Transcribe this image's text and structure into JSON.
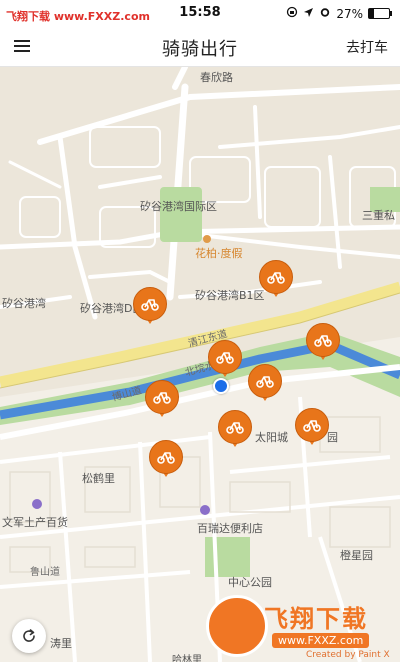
{
  "status_bar": {
    "watermark": "飞翔下载 www.FXXZ.com",
    "time": "15:58",
    "icons": [
      "lock-rotation-icon",
      "location-arrow-icon",
      "alarm-icon"
    ],
    "battery_percent_text": "27%",
    "battery_level": 0.27
  },
  "nav": {
    "menu_icon": "hamburger-menu-icon",
    "title": "骑骑出行",
    "right_action": "去打车"
  },
  "map": {
    "labels": {
      "top_road": "春欣路",
      "district": "矽谷港湾国际区",
      "sanzhong": "三重私",
      "huabo": "花柏·度假",
      "gangwan_left": "矽谷港湾",
      "gangwan_d": "矽谷港湾D区",
      "gangwan_b1": "矽谷港湾B1区",
      "qingjiang_east": "清江东道",
      "north_canal": "北垸水通",
      "boshan": "博山道",
      "taiyang": "太阳城",
      "taiyang_suffix": "园",
      "songhe": "松鹤里",
      "wenjun": "文军土产百货",
      "bairuida": "百瑞达便利店",
      "lushan": "鲁山道",
      "chenghuang": "橙星园",
      "central_park": "中心公园",
      "tao": "涛里",
      "bottom_road": "哈林里"
    },
    "bike_count": 9,
    "user_location": "user-location-dot"
  },
  "refresh_icon": "refresh-icon",
  "watermark": {
    "text": "飞翔下载",
    "url": "www.FXXZ.com",
    "credit": "Created by Paint X"
  },
  "colors": {
    "bike_marker": "#e8751a",
    "water": "#4b8ad8",
    "green": "#b9dba0",
    "road": "#ffffff",
    "major_road": "#f3e58e",
    "map_bg": "#ece6da",
    "user_dot": "#1c6de8"
  }
}
